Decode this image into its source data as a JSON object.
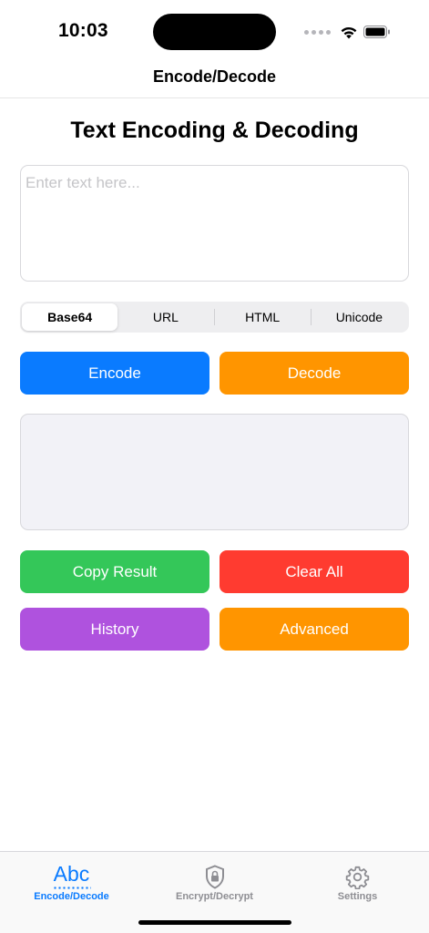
{
  "status_bar": {
    "time": "10:03"
  },
  "nav": {
    "title": "Encode/Decode"
  },
  "main": {
    "heading": "Text Encoding & Decoding",
    "input": {
      "placeholder": "Enter text here...",
      "value": ""
    },
    "segments": [
      {
        "label": "Base64",
        "selected": true
      },
      {
        "label": "URL",
        "selected": false
      },
      {
        "label": "HTML",
        "selected": false
      },
      {
        "label": "Unicode",
        "selected": false
      }
    ],
    "buttons": {
      "encode": "Encode",
      "decode": "Decode",
      "copy": "Copy Result",
      "clear": "Clear All",
      "history": "History",
      "advanced": "Advanced"
    },
    "result": ""
  },
  "tab_bar": {
    "tabs": [
      {
        "label": "Encode/Decode",
        "icon": "abc-icon",
        "active": true
      },
      {
        "label": "Encrypt/Decrypt",
        "icon": "lock-shield-icon",
        "active": false
      },
      {
        "label": "Settings",
        "icon": "gear-icon",
        "active": false
      }
    ]
  },
  "colors": {
    "blue": "#0a7bff",
    "orange": "#ff9500",
    "green": "#34c759",
    "red": "#ff3b30",
    "purple": "#af52de"
  }
}
